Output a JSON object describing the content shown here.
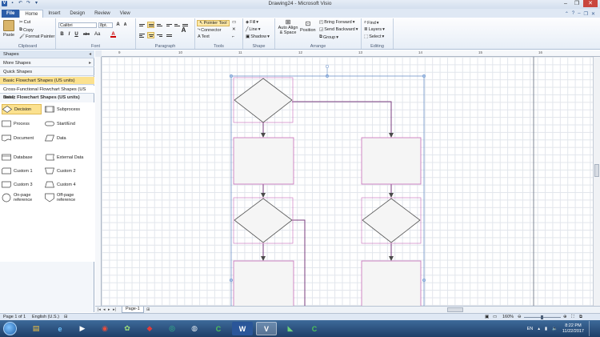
{
  "title_bar": {
    "document_title": "Drawing24 - Microsoft Visio",
    "window_buttons": [
      "–",
      "❐",
      "✕"
    ]
  },
  "ribbon_tabs": {
    "file": "File",
    "tabs": [
      "Home",
      "Insert",
      "Design",
      "Review",
      "View"
    ]
  },
  "ribbon": {
    "clipboard": {
      "paste": "Paste",
      "cut": "Cut",
      "copy": "Copy",
      "format_painter": "Format Painter",
      "label": "Clipboard"
    },
    "font": {
      "family": "Calibri",
      "size": "8pt.",
      "bold": "B",
      "italic": "I",
      "underline": "U",
      "strike": "abc",
      "label": "Font"
    },
    "paragraph": {
      "label": "Paragraph"
    },
    "tools": {
      "pointer": "Pointer Tool",
      "connector": "Connector",
      "text": "Text",
      "label": "Tools"
    },
    "shape": {
      "fill": "Fill",
      "line": "Line",
      "shadow": "Shadow",
      "label": "Shape"
    },
    "arrange": {
      "auto_align": "Auto Align & Space",
      "position": "Position",
      "bring_forward": "Bring Forward",
      "send_backward": "Send Backward",
      "group": "Group",
      "label": "Arrange"
    },
    "editing": {
      "find": "Find",
      "layers": "Layers",
      "select": "Select",
      "label": "Editing"
    }
  },
  "shapes_pane": {
    "header": "Shapes",
    "more_shapes": "More Shapes",
    "quick_shapes": "Quick Shapes",
    "basic_flowchart": "Basic Flowchart Shapes (US units)",
    "cross_functional": "Cross-Functional Flowchart Shapes (US units)",
    "stencil_title": "Basic Flowchart Shapes (US units)",
    "masters": [
      "Decision",
      "Subprocess",
      "Process",
      "Start/End",
      "Document",
      "Data",
      "Database",
      "External Data",
      "Custom 1",
      "Custom 2",
      "Custom 3",
      "Custom 4",
      "On-page reference",
      "Off-page reference"
    ]
  },
  "ruler": {
    "top_labels": [
      "9",
      "10",
      "11",
      "12",
      "13",
      "14",
      "15",
      "16"
    ]
  },
  "page_tabs": {
    "page1": "Page-1"
  },
  "status_bar": {
    "page": "Page 1 of 1",
    "language": "English (U.S.)",
    "zoom": "160%"
  },
  "taskbar": {
    "language": "EN",
    "time": "8:22 PM",
    "date": "11/22/2017"
  },
  "colors": {
    "connector": "#7a3d7f",
    "selection": "#5c87c4",
    "shape_border": "#c66bb8"
  }
}
